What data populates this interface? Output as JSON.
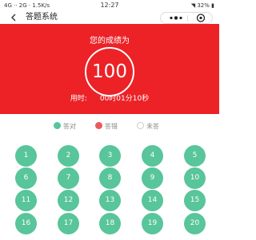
{
  "status_bar": {
    "left": "4G ·· 2G · 1.5K/s",
    "time": "12:27",
    "right": "32%"
  },
  "nav": {
    "title": "答题系统"
  },
  "result": {
    "label": "您的成绩为",
    "score": "100",
    "time_label": "用时:",
    "time_value": "00时01分10秒"
  },
  "legend": {
    "correct": "答对",
    "wrong": "答错",
    "unanswered": "未答"
  },
  "colors": {
    "accent": "#ec2227",
    "correct": "#58c59a",
    "wrong": "#e95a5d",
    "unanswered": "#ffffff"
  },
  "questions": [
    {
      "num": "1",
      "status": "correct"
    },
    {
      "num": "2",
      "status": "correct"
    },
    {
      "num": "3",
      "status": "correct"
    },
    {
      "num": "4",
      "status": "correct"
    },
    {
      "num": "5",
      "status": "correct"
    },
    {
      "num": "6",
      "status": "correct"
    },
    {
      "num": "7",
      "status": "correct"
    },
    {
      "num": "8",
      "status": "correct"
    },
    {
      "num": "9",
      "status": "correct"
    },
    {
      "num": "10",
      "status": "correct"
    },
    {
      "num": "11",
      "status": "correct"
    },
    {
      "num": "12",
      "status": "correct"
    },
    {
      "num": "13",
      "status": "correct"
    },
    {
      "num": "14",
      "status": "correct"
    },
    {
      "num": "15",
      "status": "correct"
    },
    {
      "num": "16",
      "status": "correct"
    },
    {
      "num": "17",
      "status": "correct"
    },
    {
      "num": "18",
      "status": "correct"
    },
    {
      "num": "19",
      "status": "correct"
    },
    {
      "num": "20",
      "status": "correct"
    }
  ]
}
